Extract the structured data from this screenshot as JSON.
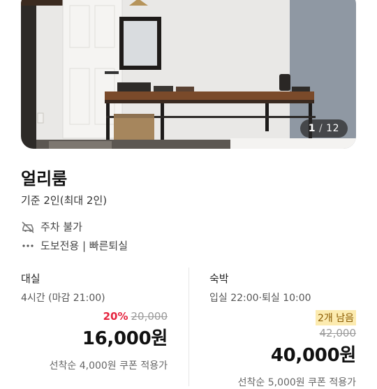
{
  "photo": {
    "counter_current": "1",
    "counter_sep": "/",
    "counter_total": "12"
  },
  "room": {
    "title": "얼리룸",
    "capacity": "기준 2인(최대 2인)"
  },
  "features": {
    "parking": {
      "icon": "no-parking-icon",
      "label": "주차 불가"
    },
    "walk": {
      "icon": "more-dots-icon",
      "label": "도보전용 | 빠른퇴실"
    }
  },
  "day_use": {
    "label": "대실",
    "time": "4시간 (마감 21:00)",
    "discount_pct": "20%",
    "original_price": "20,000",
    "price": "16,000원",
    "coupon_note": "선착순 4,000원 쿠폰 적용가"
  },
  "stay": {
    "label": "숙박",
    "time": "입실 22:00·퇴실 10:00",
    "remaining_badge": "2개 남음",
    "original_price": "42,000",
    "price": "40,000원",
    "coupon_note": "선착순 5,000원 쿠폰 적용가"
  },
  "colors": {
    "discount": "#e5243f",
    "badge_bg": "#fcebb0",
    "badge_text": "#8a5a00"
  }
}
